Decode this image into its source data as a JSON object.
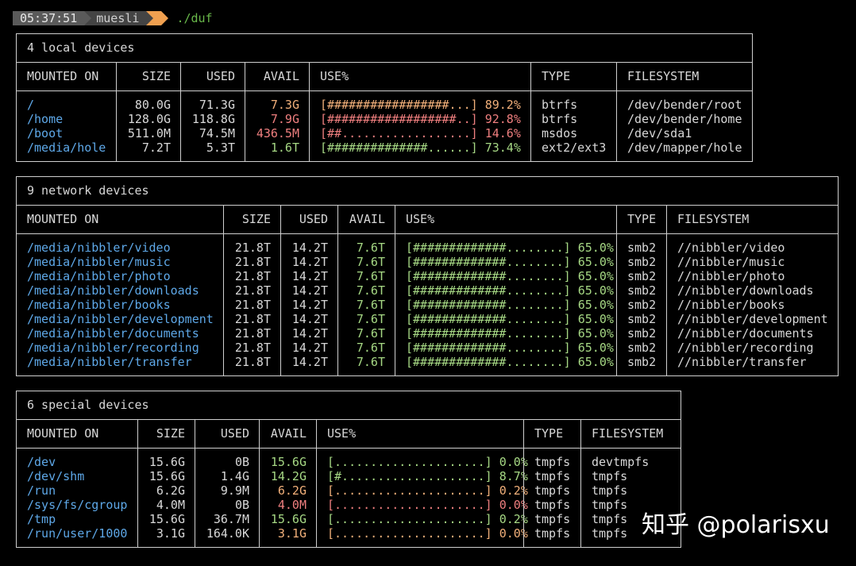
{
  "prompt": {
    "time": "05:37:51",
    "user": "muesli",
    "command": "./duf"
  },
  "colors": {
    "mount": "#5ea8e8",
    "avail_ok": "#a6d884",
    "avail_warn": "#f2b07a",
    "avail_crit": "#ef7f7f",
    "prompt_arrow": "#f0a050"
  },
  "headers": {
    "mounted_on": "MOUNTED ON",
    "size": "SIZE",
    "used": "USED",
    "avail": "AVAIL",
    "use": "USE%",
    "type": "TYPE",
    "filesystem": "FILESYSTEM"
  },
  "tables": [
    {
      "title": "4 local devices",
      "rows": [
        {
          "mount": "/",
          "size": "80.0G",
          "used": "71.3G",
          "avail": "7.3G",
          "bar": "[#################...]",
          "pct": "89.2%",
          "type": "btrfs",
          "fs": "/dev/bender/root",
          "level": "warn"
        },
        {
          "mount": "/home",
          "size": "128.0G",
          "used": "118.8G",
          "avail": "7.9G",
          "bar": "[##################..]",
          "pct": "92.8%",
          "type": "btrfs",
          "fs": "/dev/bender/home",
          "level": "crit"
        },
        {
          "mount": "/boot",
          "size": "511.0M",
          "used": "74.5M",
          "avail": "436.5M",
          "bar": "[##..................]",
          "pct": "14.6%",
          "type": "msdos",
          "fs": "/dev/sda1",
          "level": "crit"
        },
        {
          "mount": "/media/hole",
          "size": "7.2T",
          "used": "5.3T",
          "avail": "1.6T",
          "bar": "[##############......]",
          "pct": "73.4%",
          "type": "ext2/ext3",
          "fs": "/dev/mapper/hole",
          "level": "ok"
        }
      ]
    },
    {
      "title": "9 network devices",
      "rows": [
        {
          "mount": "/media/nibbler/video",
          "size": "21.8T",
          "used": "14.2T",
          "avail": "7.6T",
          "bar": "[#############........]",
          "pct": "65.0%",
          "type": "smb2",
          "fs": "//nibbler/video",
          "level": "ok"
        },
        {
          "mount": "/media/nibbler/music",
          "size": "21.8T",
          "used": "14.2T",
          "avail": "7.6T",
          "bar": "[#############........]",
          "pct": "65.0%",
          "type": "smb2",
          "fs": "//nibbler/music",
          "level": "ok"
        },
        {
          "mount": "/media/nibbler/photo",
          "size": "21.8T",
          "used": "14.2T",
          "avail": "7.6T",
          "bar": "[#############........]",
          "pct": "65.0%",
          "type": "smb2",
          "fs": "//nibbler/photo",
          "level": "ok"
        },
        {
          "mount": "/media/nibbler/downloads",
          "size": "21.8T",
          "used": "14.2T",
          "avail": "7.6T",
          "bar": "[#############........]",
          "pct": "65.0%",
          "type": "smb2",
          "fs": "//nibbler/downloads",
          "level": "ok"
        },
        {
          "mount": "/media/nibbler/books",
          "size": "21.8T",
          "used": "14.2T",
          "avail": "7.6T",
          "bar": "[#############........]",
          "pct": "65.0%",
          "type": "smb2",
          "fs": "//nibbler/books",
          "level": "ok"
        },
        {
          "mount": "/media/nibbler/development",
          "size": "21.8T",
          "used": "14.2T",
          "avail": "7.6T",
          "bar": "[#############........]",
          "pct": "65.0%",
          "type": "smb2",
          "fs": "//nibbler/development",
          "level": "ok"
        },
        {
          "mount": "/media/nibbler/documents",
          "size": "21.8T",
          "used": "14.2T",
          "avail": "7.6T",
          "bar": "[#############........]",
          "pct": "65.0%",
          "type": "smb2",
          "fs": "//nibbler/documents",
          "level": "ok"
        },
        {
          "mount": "/media/nibbler/recording",
          "size": "21.8T",
          "used": "14.2T",
          "avail": "7.6T",
          "bar": "[#############........]",
          "pct": "65.0%",
          "type": "smb2",
          "fs": "//nibbler/recording",
          "level": "ok"
        },
        {
          "mount": "/media/nibbler/transfer",
          "size": "21.8T",
          "used": "14.2T",
          "avail": "7.6T",
          "bar": "[#############........]",
          "pct": "65.0%",
          "type": "smb2",
          "fs": "//nibbler/transfer",
          "level": "ok"
        }
      ]
    },
    {
      "title": "6 special devices",
      "rows": [
        {
          "mount": "/dev",
          "size": "15.6G",
          "used": "0B",
          "avail": "15.6G",
          "bar": "[.....................]",
          "pct": "0.0%",
          "type": "tmpfs",
          "fs": "devtmpfs",
          "level": "ok"
        },
        {
          "mount": "/dev/shm",
          "size": "15.6G",
          "used": "1.4G",
          "avail": "14.2G",
          "bar": "[#....................]",
          "pct": "8.7%",
          "type": "tmpfs",
          "fs": "tmpfs",
          "level": "ok"
        },
        {
          "mount": "/run",
          "size": "6.2G",
          "used": "9.9M",
          "avail": "6.2G",
          "bar": "[.....................]",
          "pct": "0.2%",
          "type": "tmpfs",
          "fs": "tmpfs",
          "level": "warn"
        },
        {
          "mount": "/sys/fs/cgroup",
          "size": "4.0M",
          "used": "0B",
          "avail": "4.0M",
          "bar": "[.....................]",
          "pct": "0.0%",
          "type": "tmpfs",
          "fs": "tmpfs",
          "level": "crit"
        },
        {
          "mount": "/tmp",
          "size": "15.6G",
          "used": "36.7M",
          "avail": "15.6G",
          "bar": "[.....................]",
          "pct": "0.2%",
          "type": "tmpfs",
          "fs": "tmpfs",
          "level": "ok"
        },
        {
          "mount": "/run/user/1000",
          "size": "3.1G",
          "used": "164.0K",
          "avail": "3.1G",
          "bar": "[.....................]",
          "pct": "0.0%",
          "type": "tmpfs",
          "fs": "tmpfs",
          "level": "warn"
        }
      ]
    }
  ],
  "watermark": "知乎 @polarisxu"
}
